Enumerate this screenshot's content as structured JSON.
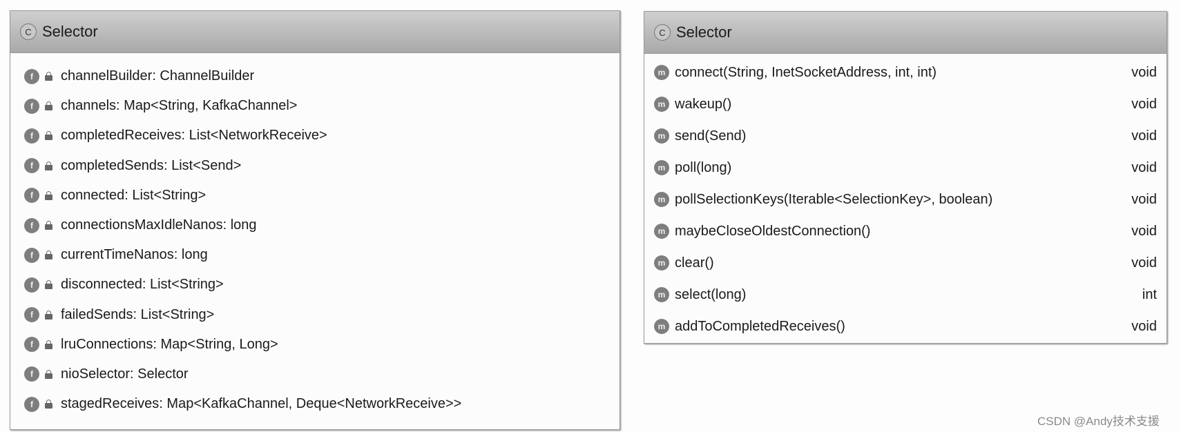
{
  "fields_panel": {
    "title": "Selector",
    "class_icon": "class-icon",
    "field_icon": "field-icon",
    "items": [
      "channelBuilder: ChannelBuilder",
      "channels: Map<String, KafkaChannel>",
      "completedReceives: List<NetworkReceive>",
      "completedSends: List<Send>",
      "connected: List<String>",
      "connectionsMaxIdleNanos: long",
      "currentTimeNanos: long",
      "disconnected: List<String>",
      "failedSends: List<String>",
      "lruConnections: Map<String, Long>",
      "nioSelector: Selector",
      "stagedReceives: Map<KafkaChannel, Deque<NetworkReceive>>"
    ]
  },
  "methods_panel": {
    "title": "Selector",
    "method_icon": "method-icon",
    "items": [
      {
        "name": "connect(String, InetSocketAddress, int, int)",
        "ret": "void"
      },
      {
        "name": "wakeup()",
        "ret": "void"
      },
      {
        "name": "send(Send)",
        "ret": "void"
      },
      {
        "name": "poll(long)",
        "ret": "void"
      },
      {
        "name": "pollSelectionKeys(Iterable<SelectionKey>, boolean)",
        "ret": "void"
      },
      {
        "name": "maybeCloseOldestConnection()",
        "ret": "void"
      },
      {
        "name": "clear()",
        "ret": "void"
      },
      {
        "name": "select(long)",
        "ret": "int"
      },
      {
        "name": "addToCompletedReceives()",
        "ret": "void"
      }
    ]
  },
  "watermark": "CSDN @Andy技术支援"
}
